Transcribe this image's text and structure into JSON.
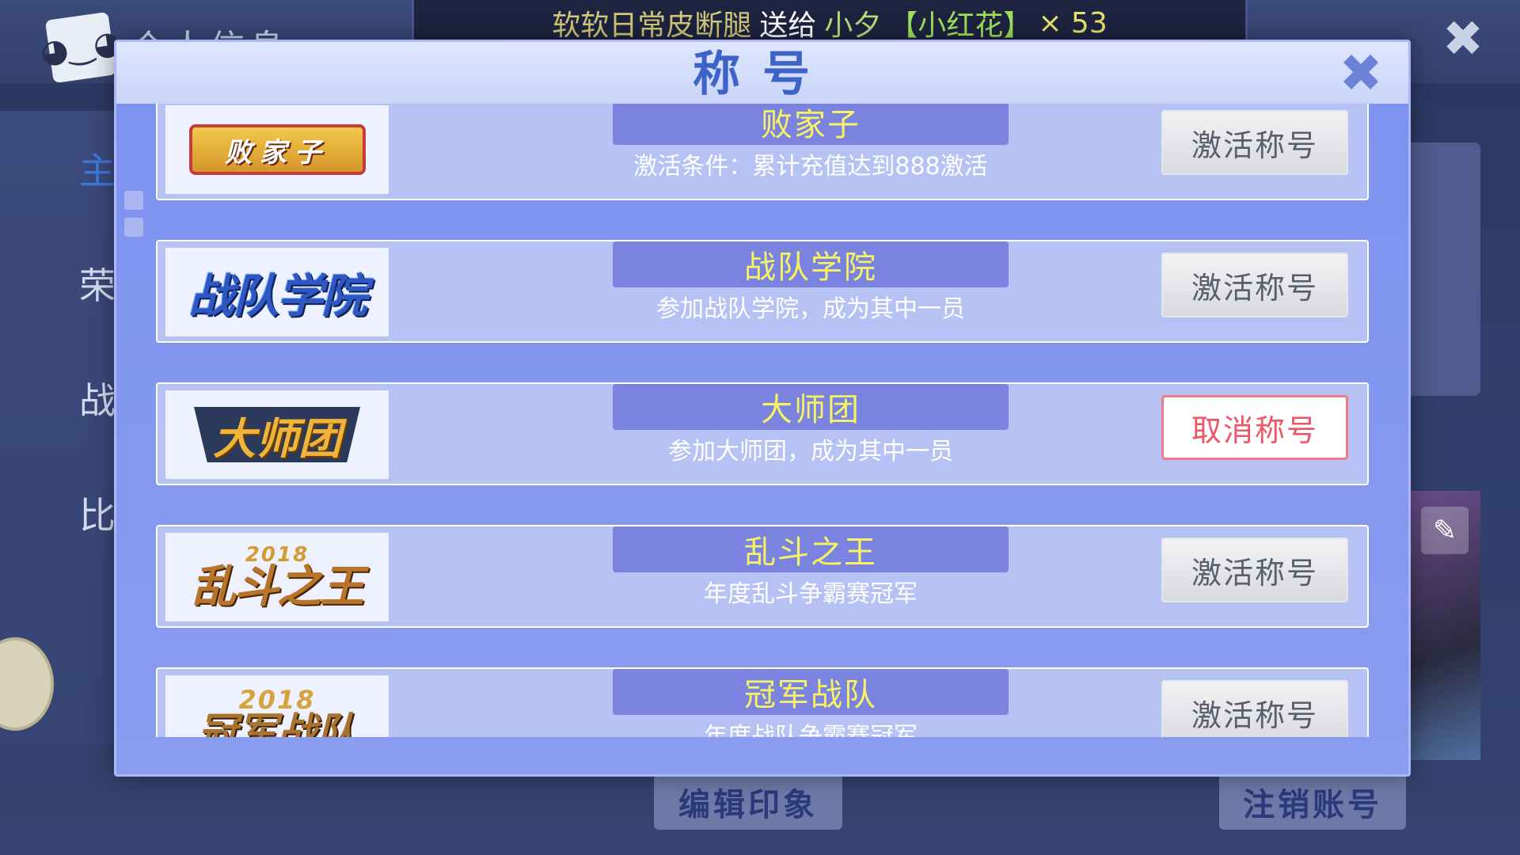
{
  "background": {
    "page_title": "个人信息",
    "avatar_glyph": "◕‿◕",
    "close_glyph": "✖",
    "nav_items": [
      "主",
      "荣",
      "战",
      "比"
    ],
    "edit_icon_glyph": "✎",
    "bottom_buttons": {
      "edit_impression": "编辑印象",
      "logout_account": "注销账号"
    }
  },
  "ticker": {
    "sender": "软软日常皮断腿",
    "verb": "送给",
    "receiver": "小夕",
    "item": "【小红花】",
    "count": "× 53"
  },
  "modal": {
    "title": "称号",
    "close_glyph": "✖",
    "titles": [
      {
        "logo_text": "败家子",
        "name": "败家子",
        "condition": "激活条件：累计充值达到888激活",
        "button": "激活称号",
        "active": false
      },
      {
        "logo_text": "战队学院",
        "name": "战队学院",
        "condition": "参加战队学院，成为其中一员",
        "button": "激活称号",
        "active": false
      },
      {
        "logo_text": "大师团",
        "name": "大师团",
        "condition": "参加大师团，成为其中一员",
        "button": "取消称号",
        "active": true
      },
      {
        "logo_year": "2018",
        "logo_text": "乱斗之王",
        "name": "乱斗之王",
        "condition": "年度乱斗争霸赛冠军",
        "button": "激活称号",
        "active": false
      },
      {
        "logo_year": "2018",
        "logo_text": "冠军战队",
        "name": "冠军战队",
        "condition": "年度战队争霸赛冠军",
        "button": "激活称号",
        "active": false
      }
    ]
  },
  "colors": {
    "accent_title": "#3d63c8",
    "badge_bg": "#7a84e0",
    "badge_text": "#f7f262",
    "cancel_text": "#ee5566"
  }
}
